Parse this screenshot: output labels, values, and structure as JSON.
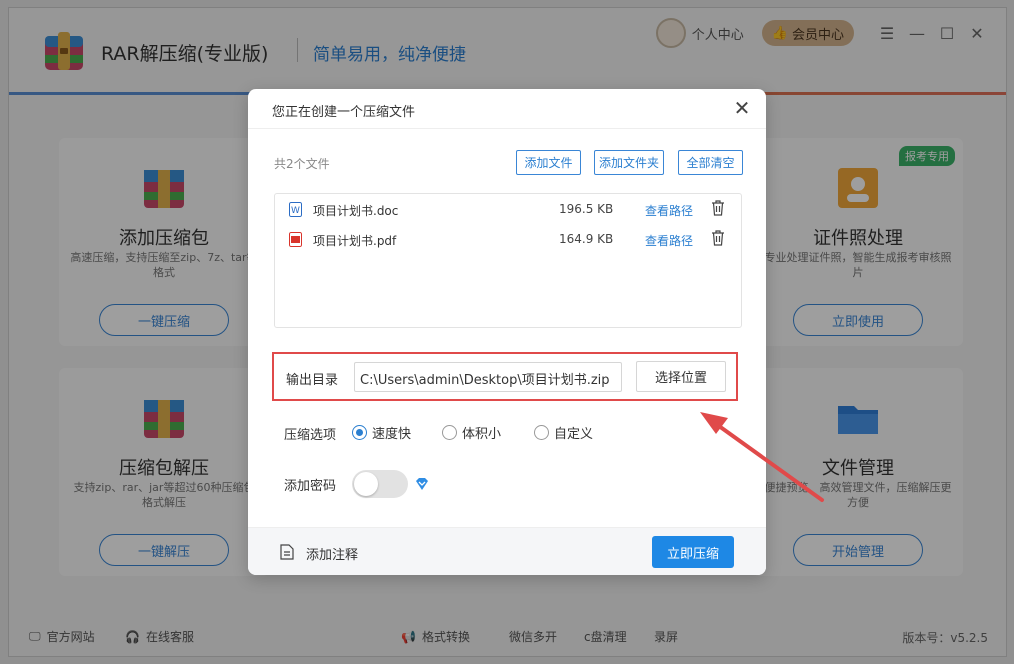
{
  "app": {
    "title": "RAR解压缩(专业版)",
    "slogan": "简单易用，纯净便捷",
    "user_center": "个人中心",
    "vip_center": "会员中心"
  },
  "cards": [
    {
      "title": "添加压缩包",
      "desc": "高速压缩，支持压缩至zip、7z、tar等格式",
      "button": "一键压缩",
      "icon": "archive-add-icon"
    },
    {
      "title": "证件照处理",
      "desc": "专业处理证件照，智能生成报考审核照片",
      "button": "立即使用",
      "icon": "id-photo-icon",
      "badge": "报考专用"
    },
    {
      "title": "压缩包解压",
      "desc": "支持zip、rar、jar等超过60种压缩包格式解压",
      "button": "一键解压",
      "icon": "archive-extract-icon"
    },
    {
      "title": "文件管理",
      "desc": "便捷预览、高效管理文件，压缩解压更方便",
      "button": "开始管理",
      "icon": "folder-icon"
    }
  ],
  "footer": {
    "website": "官方网站",
    "service": "在线客服",
    "convert": "格式转换",
    "wechat": "微信多开",
    "cclean": "c盘清理",
    "record": "录屏",
    "version": "版本号：v5.2.5"
  },
  "dialog": {
    "title": "您正在创建一个压缩文件",
    "file_count": "共2个文件",
    "add_file": "添加文件",
    "add_folder": "添加文件夹",
    "clear_all": "全部清空",
    "files": [
      {
        "name": "项目计划书.doc",
        "size": "196.5 KB",
        "action": "查看路径",
        "type": "word"
      },
      {
        "name": "项目计划书.pdf",
        "size": "164.9 KB",
        "action": "查看路径",
        "type": "pdf"
      }
    ],
    "output_label": "输出目录",
    "output_path": "C:\\Users\\admin\\Desktop\\项目计划书.zip",
    "choose_location": "选择位置",
    "options_label": "压缩选项",
    "options": [
      {
        "label": "速度快",
        "selected": true
      },
      {
        "label": "体积小",
        "selected": false
      },
      {
        "label": "自定义",
        "selected": false
      }
    ],
    "password_label": "添加密码",
    "password_enabled": false,
    "add_note": "添加注释",
    "compress_now": "立即压缩"
  },
  "colors": {
    "accent": "#1e88e5",
    "highlight_red": "#e04a4a"
  }
}
